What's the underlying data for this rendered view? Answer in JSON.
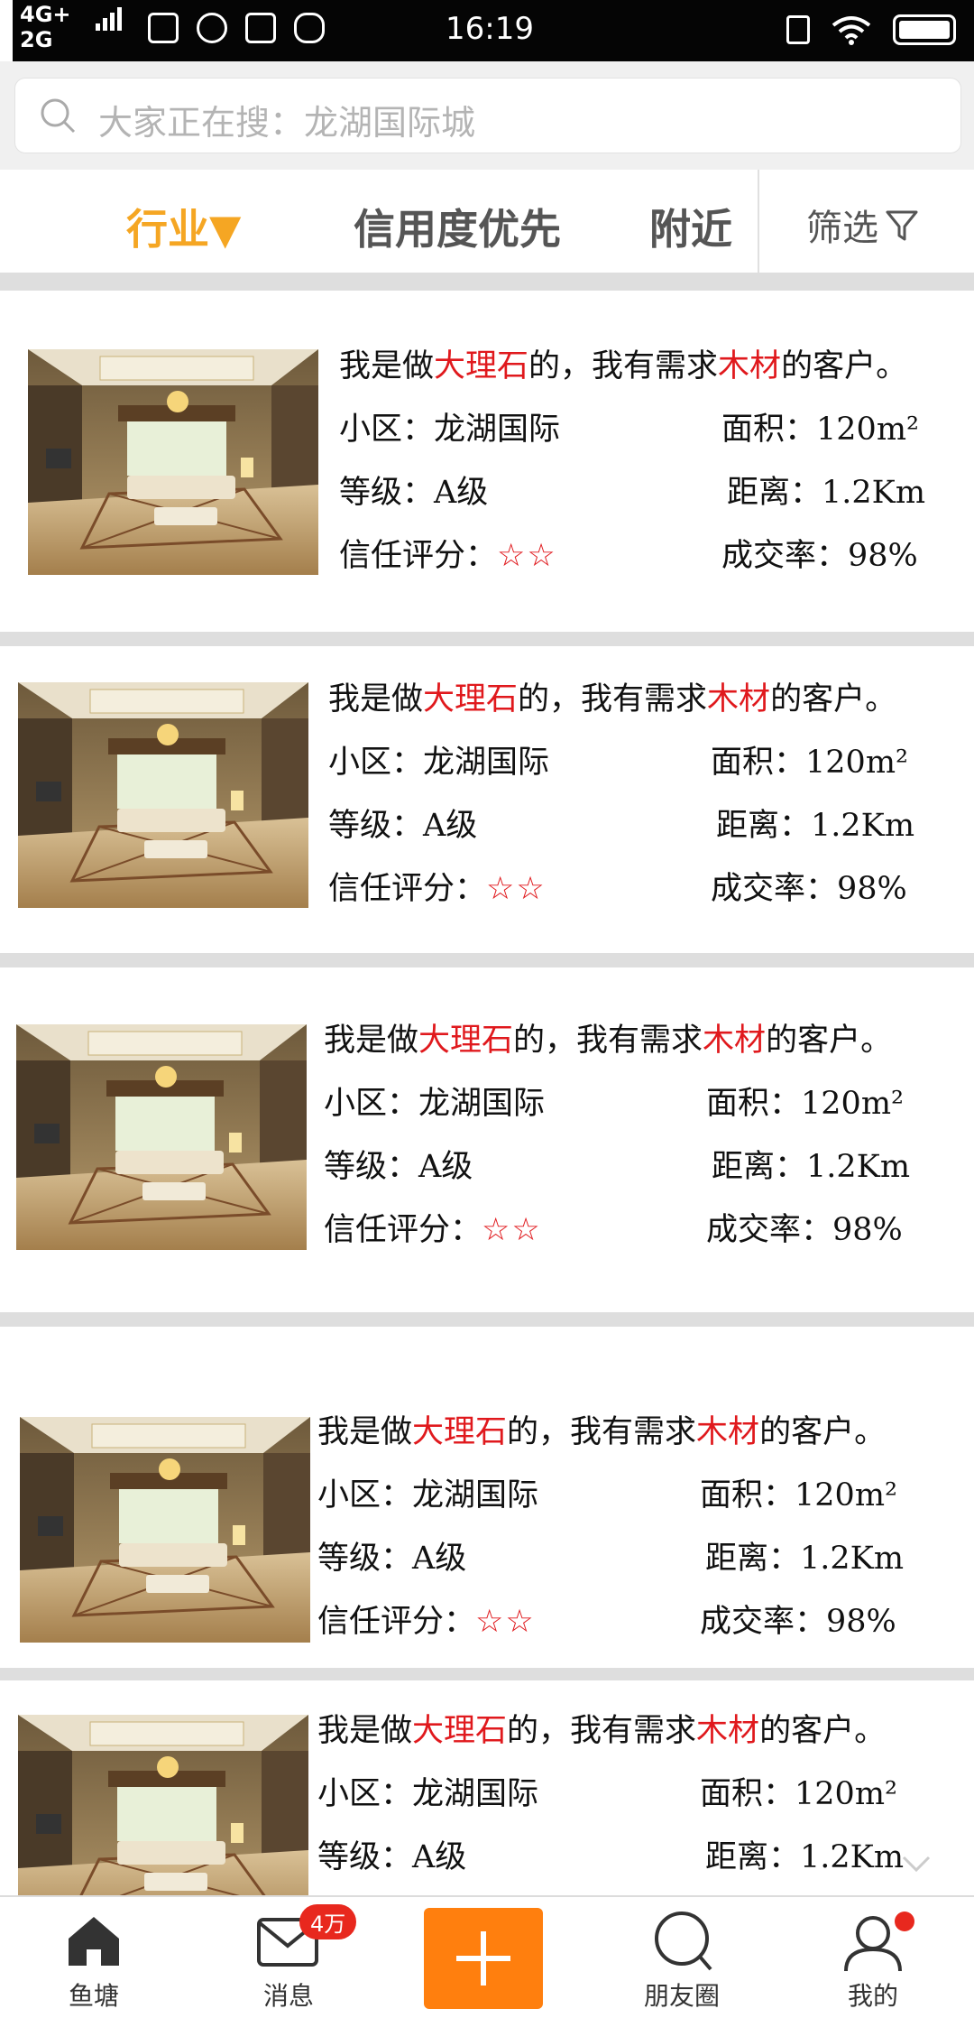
{
  "status_bar": {
    "network_top": "4G+",
    "network_bottom": "2G",
    "time": "16:19",
    "app_icons": [
      "taobao-icon",
      "qq-icon",
      "s-icon",
      "bull-icon"
    ]
  },
  "search": {
    "placeholder": "大家正在搜：龙湖国际城"
  },
  "filters": {
    "industry": "行业▼",
    "credit": "信用度优先",
    "nearby": "附近",
    "screen": "筛选"
  },
  "cards": [
    {
      "title_pre": "我是做",
      "title_hl1": "大理石",
      "title_mid": "的，我有需求",
      "title_hl2": "木材",
      "title_post": "的客户。",
      "community_label": "小区：",
      "community": "龙湖国际",
      "area_label": "面积：",
      "area": "120m²",
      "level_label": "等级：",
      "level": "A级",
      "distance_label": "距离：",
      "distance": "1.2Km",
      "trust_label": "信任评分：",
      "trust_stars": "☆☆",
      "rate_label": "成交率：",
      "rate": "98%"
    },
    {
      "title_pre": "我是做",
      "title_hl1": "大理石",
      "title_mid": "的，我有需求",
      "title_hl2": "木材",
      "title_post": "的客户。",
      "community_label": "小区：",
      "community": "龙湖国际",
      "area_label": "面积：",
      "area": "120m²",
      "level_label": "等级：",
      "level": "A级",
      "distance_label": "距离：",
      "distance": "1.2Km",
      "trust_label": "信任评分：",
      "trust_stars": "☆☆",
      "rate_label": "成交率：",
      "rate": "98%"
    },
    {
      "title_pre": "我是做",
      "title_hl1": "大理石",
      "title_mid": "的，我有需求",
      "title_hl2": "木材",
      "title_post": "的客户。",
      "community_label": "小区：",
      "community": "龙湖国际",
      "area_label": "面积：",
      "area": "120m²",
      "level_label": "等级：",
      "level": "A级",
      "distance_label": "距离：",
      "distance": "1.2Km",
      "trust_label": "信任评分：",
      "trust_stars": "☆☆",
      "rate_label": "成交率：",
      "rate": "98%"
    },
    {
      "title_pre": "我是做",
      "title_hl1": "大理石",
      "title_mid": "的，我有需求",
      "title_hl2": "木材",
      "title_post": "的客户。",
      "community_label": "小区：",
      "community": "龙湖国际",
      "area_label": "面积：",
      "area": "120m²",
      "level_label": "等级：",
      "level": "A级",
      "distance_label": "距离：",
      "distance": "1.2Km",
      "trust_label": "信任评分：",
      "trust_stars": "☆☆",
      "rate_label": "成交率：",
      "rate": "98%"
    },
    {
      "title_pre": "我是做",
      "title_hl1": "大理石",
      "title_mid": "的，我有需求",
      "title_hl2": "木材",
      "title_post": "的客户。",
      "community_label": "小区：",
      "community": "龙湖国际",
      "area_label": "面积：",
      "area": "120m²",
      "level_label": "等级：",
      "level": "A级",
      "distance_label": "距离：",
      "distance": "1.2Km"
    }
  ],
  "bottom_nav": {
    "home": "鱼塘",
    "messages": "消息",
    "messages_badge": "4万",
    "friends": "朋友圈",
    "mine": "我的"
  },
  "colors": {
    "accent_orange": "#ff7f0e",
    "active_filter": "#f5a623",
    "highlight_red": "#e0191d"
  }
}
